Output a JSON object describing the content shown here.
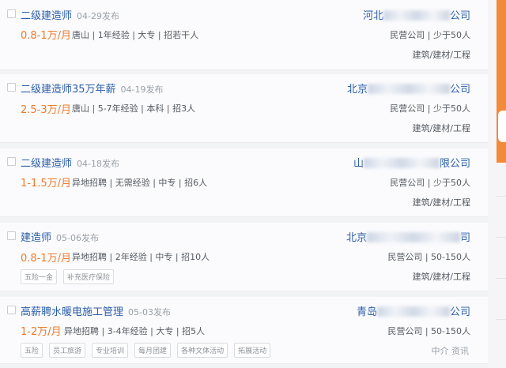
{
  "jobs": [
    {
      "title": "二级建造师",
      "posted": "04-29发布",
      "salary": "0.8-1万/月",
      "meta": "唐山 | 1年经验 | 大专 | 招若干人",
      "company_visible_start": "河北",
      "company_visible_end": "公司",
      "company_type": "民营公司 | 少于50人",
      "industry": "建筑/建材/工程",
      "tags": []
    },
    {
      "title": "二级建造师35万年薪",
      "posted": "04-19发布",
      "salary": "2.5-3万/月",
      "meta": "唐山 | 5-7年经验 | 本科 | 招3人",
      "company_visible_start": "北京",
      "company_visible_end": "公司",
      "company_type": "民营公司 | 少于50人",
      "industry": "建筑/建材/工程",
      "tags": []
    },
    {
      "title": "二级建造师",
      "posted": "04-18发布",
      "salary": "1-1.5万/月",
      "meta": "异地招聘 | 无需经验 | 中专 | 招6人",
      "company_visible_start": "山",
      "company_visible_end": "限公司",
      "company_type": "民营公司 | 少于50人",
      "industry": "建筑/建材/工程",
      "tags": []
    },
    {
      "title": "建造师",
      "posted": "05-06发布",
      "salary": "0.8-1万/月",
      "meta": "异地招聘 | 2年经验 | 中专 | 招10人",
      "company_visible_start": "北京",
      "company_visible_end": "司",
      "company_type": "民营公司 | 50-150人",
      "industry": "建筑/建材/工程",
      "tags": [
        "五险一金",
        "补充医疗保险"
      ]
    },
    {
      "title": "高薪聘水暖电施工管理",
      "posted": "05-03发布",
      "salary": "1-2万/月",
      "meta": "异地招聘 | 3-4年经验 | 大专 | 招5人",
      "company_visible_start": "青岛",
      "company_visible_end": "公司",
      "company_type": "民营公司 | 50-150人",
      "industry": "",
      "tags": [
        "五险",
        "员工旅游",
        "专业培训",
        "每月团建",
        "各种文体活动",
        "拓展活动"
      ]
    }
  ],
  "watermark": "中介 资讯",
  "colors": {
    "link": "#2b5ea8",
    "salary": "#ee7a2a",
    "side_accent": "#f28a3a"
  }
}
